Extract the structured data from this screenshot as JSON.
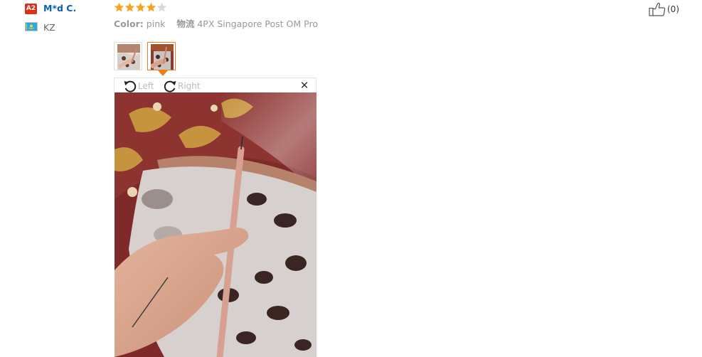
{
  "reviewer": {
    "level_badge": "A2",
    "name": "M*d C.",
    "country_code": "KZ",
    "flag_icon": "kazakhstan-flag-icon"
  },
  "review": {
    "rating": 4,
    "rating_max": 5,
    "color_label": "Color:",
    "color_value": "pink",
    "shipping_label": "物流",
    "shipping_value": "4PX Singapore Post OM Pro"
  },
  "helpful": {
    "icon": "thumbs-up-icon",
    "count_text": "(0)"
  },
  "gallery": {
    "selected_index": 1,
    "viewer": {
      "rotate_left_label": "Left",
      "rotate_right_label": "Right",
      "close_icon": "close-icon"
    }
  },
  "colors": {
    "username": "#0a5fb4",
    "badge": "#d9321c",
    "star_filled": "#f7a21a",
    "star_empty": "#d8d8d8",
    "selection": "#f07c1b"
  }
}
